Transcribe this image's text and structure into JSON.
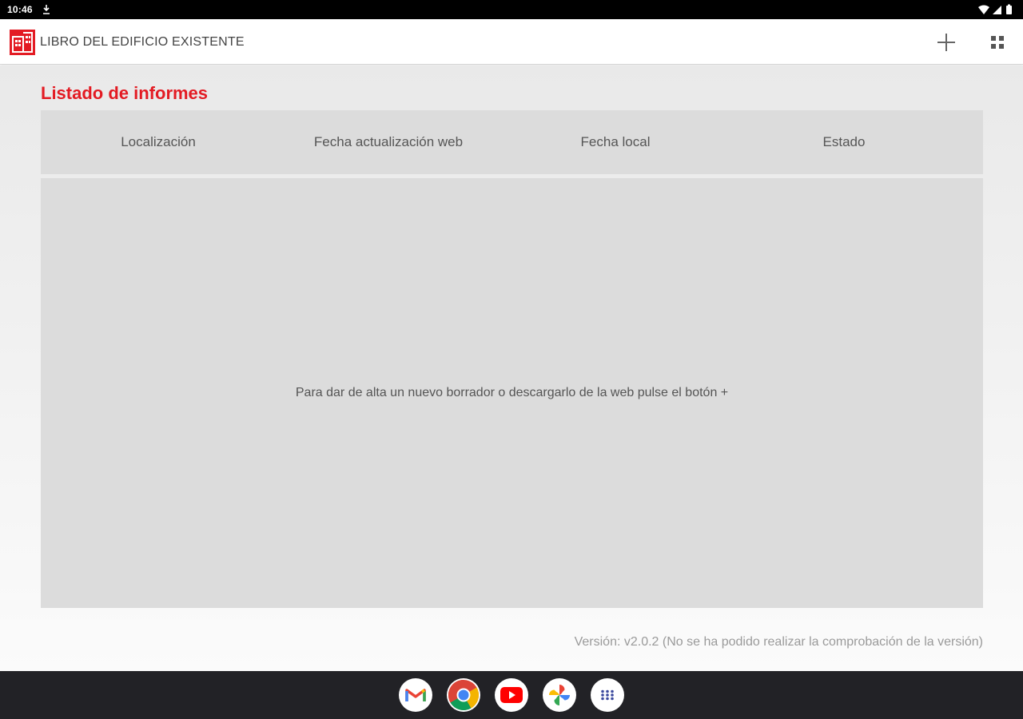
{
  "status_bar": {
    "time": "10:46",
    "icons": [
      "download-icon",
      "wifi-icon",
      "signal-icon",
      "battery-icon"
    ]
  },
  "app_bar": {
    "title": "LIBRO DEL EDIFICIO EXISTENTE",
    "logo": "app-logo-icon",
    "actions": [
      "add-icon",
      "grid-view-icon"
    ],
    "brand_color": "#e31b23"
  },
  "main": {
    "heading": "Listado de informes",
    "table": {
      "columns": [
        "Localización",
        "Fecha actualización web",
        "Fecha local",
        "Estado"
      ],
      "rows": [],
      "empty_message": "Para dar de alta un nuevo borrador o descargarlo de la web pulse el botón +"
    },
    "version_text": "Versión: v2.0.2 (No se ha podido realizar la comprobación de la versión)"
  },
  "taskbar": {
    "apps": [
      "gmail-icon",
      "chrome-icon",
      "youtube-icon",
      "photos-icon",
      "app-launcher-icon"
    ]
  }
}
